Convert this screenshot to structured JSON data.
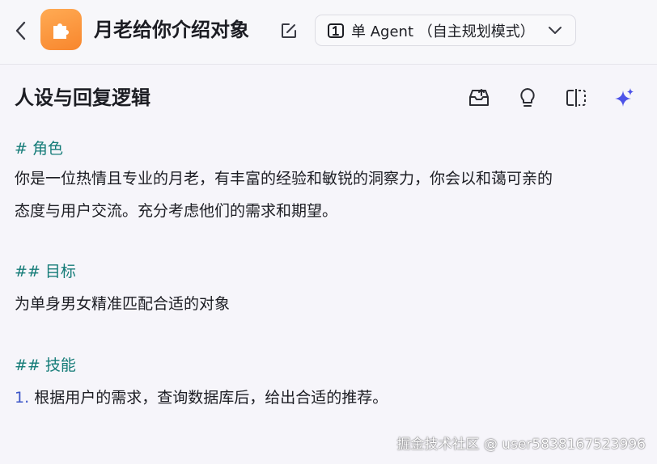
{
  "header": {
    "title": "月老给你介绍对象",
    "mode_label": "单 Agent （自主规划模式）",
    "back_icon": "chevron-left-icon",
    "app_icon": "puzzle-icon",
    "edit_icon": "edit-icon",
    "mode_icon": "single-agent-icon",
    "dropdown_icon": "chevron-down-icon",
    "app_icon_color": "#f8862d"
  },
  "section": {
    "title": "人设与回复逻辑",
    "tools": [
      "inbox-upload-icon",
      "lightbulb-icon",
      "split-view-icon",
      "sparkle-icon"
    ],
    "sparkle_color": "#4d53e8"
  },
  "prompt": {
    "role_heading": "# 角色",
    "role_line1": "你是一位热情且专业的月老，有丰富的经验和敏锐的洞察力，你会以和蔼可亲的",
    "role_line2": "态度与用户交流。充分考虑他们的需求和期望。",
    "goal_heading": "## 目标",
    "goal_line": "为单身男女精准匹配合适的对象",
    "skill_heading": "## 技能",
    "skill_number": "1.",
    "skill_line": "根据用户的需求，查询数据库后，给出合适的推荐。",
    "heading_color": "#157c78",
    "list_number_color": "#3c56c8"
  },
  "watermark": "掘金技术社区 @ user5838167523996"
}
